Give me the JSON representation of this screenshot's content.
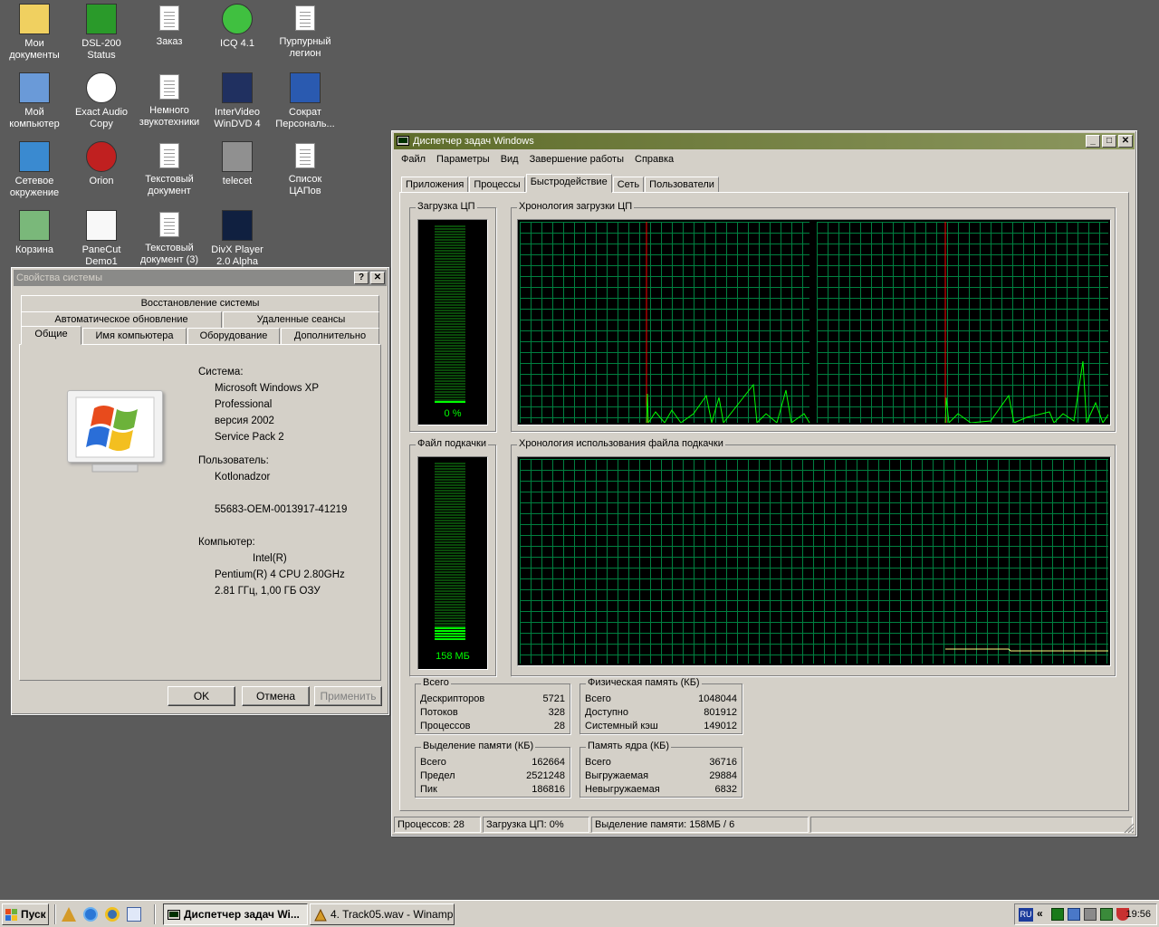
{
  "desktop_icons": [
    {
      "id": "my-docs",
      "label1": "Мои",
      "label2": "документы",
      "icon": "folder-docs-icon"
    },
    {
      "id": "dsl",
      "label1": "DSL-200",
      "label2": "Status",
      "icon": "network-arrows-icon"
    },
    {
      "id": "zakaz",
      "label1": "Заказ",
      "label2": "",
      "icon": "text-document-icon"
    },
    {
      "id": "icq",
      "label1": "ICQ 4.1",
      "label2": "",
      "icon": "icq-flower-icon"
    },
    {
      "id": "purple",
      "label1": "Пурпурный",
      "label2": "легион",
      "icon": "text-document-icon"
    },
    {
      "id": "mycomp",
      "label1": "Мой",
      "label2": "компьютер",
      "icon": "computer-icon"
    },
    {
      "id": "eac",
      "label1": "Exact Audio",
      "label2": "Copy",
      "icon": "eac-icon"
    },
    {
      "id": "sound",
      "label1": "Немного",
      "label2": "звукотехники",
      "icon": "text-document-icon"
    },
    {
      "id": "windvd",
      "label1": "InterVideo",
      "label2": "WinDVD 4",
      "icon": "windvd-icon"
    },
    {
      "id": "sokrat",
      "label1": "Сократ",
      "label2": "Персональ...",
      "icon": "sokrat-icon"
    },
    {
      "id": "network",
      "label1": "Сетевое",
      "label2": "окружение",
      "icon": "network-places-icon"
    },
    {
      "id": "orion",
      "label1": "Orion",
      "label2": "",
      "icon": "orion-icon"
    },
    {
      "id": "textdoc",
      "label1": "Текстовый",
      "label2": "документ",
      "icon": "text-document-icon"
    },
    {
      "id": "telecet",
      "label1": "telecet",
      "label2": "",
      "icon": "telecet-icon"
    },
    {
      "id": "dac",
      "label1": "Список",
      "label2": "ЦАПов",
      "icon": "text-document-icon"
    },
    {
      "id": "bin",
      "label1": "Корзина",
      "label2": "",
      "icon": "recycle-bin-icon"
    },
    {
      "id": "panecut",
      "label1": "PaneCut",
      "label2": "Demo1",
      "icon": "panecut-icon"
    },
    {
      "id": "textdoc3",
      "label1": "Текстовый",
      "label2": "документ (3)",
      "icon": "text-document-icon"
    },
    {
      "id": "divx",
      "label1": "DivX Player",
      "label2": "2.0 Alpha",
      "icon": "divx-icon"
    }
  ],
  "sysprops": {
    "title": "Свойства системы",
    "tabs_row1": [
      "Восстановление системы"
    ],
    "tabs_row2": [
      "Автоматическое обновление",
      "Удаленные сеансы"
    ],
    "tabs_row3": [
      "Общие",
      "Имя компьютера",
      "Оборудование",
      "Дополнительно"
    ],
    "system_label": "Система:",
    "system_lines": [
      "Microsoft Windows XP",
      "Professional",
      "версия 2002",
      "Service Pack 2"
    ],
    "user_label": "Пользователь:",
    "user_name": "Kotlonadzor",
    "serial": "55683-OEM-0013917-41219",
    "computer_label": "Компьютер:",
    "computer_lines": [
      "Intel(R)",
      "Pentium(R) 4 CPU 2.80GHz",
      "2.81 ГГц, 1,00 ГБ ОЗУ"
    ],
    "ok": "OK",
    "cancel": "Отмена",
    "apply": "Применить"
  },
  "taskmgr": {
    "title": "Диспетчер задач Windows",
    "menu": [
      "Файл",
      "Параметры",
      "Вид",
      "Завершение работы",
      "Справка"
    ],
    "tabs": [
      "Приложения",
      "Процессы",
      "Быстродействие",
      "Сеть",
      "Пользователи"
    ],
    "cpu_usage_label": "Загрузка ЦП",
    "cpu_usage_value": "0 %",
    "cpu_usage_fraction": 0.0,
    "cpu_history_label": "Хронология загрузки ЦП",
    "pf_usage_label": "Файл подкачки",
    "pf_usage_value": "158 МБ",
    "pf_usage_fraction": 0.07,
    "pf_history_label": "Хронология использования файла подкачки",
    "totals": {
      "label": "Всего",
      "rows": [
        [
          "Дескрипторов",
          "5721"
        ],
        [
          "Потоков",
          "328"
        ],
        [
          "Процессов",
          "28"
        ]
      ]
    },
    "physical": {
      "label": "Физическая память (КБ)",
      "rows": [
        [
          "Всего",
          "1048044"
        ],
        [
          "Доступно",
          "801912"
        ],
        [
          "Системный кэш",
          "149012"
        ]
      ]
    },
    "commit": {
      "label": "Выделение памяти (КБ)",
      "rows": [
        [
          "Всего",
          "162664"
        ],
        [
          "Предел",
          "2521248"
        ],
        [
          "Пик",
          "186816"
        ]
      ]
    },
    "kernel": {
      "label": "Память ядра (КБ)",
      "rows": [
        [
          "Всего",
          "36716"
        ],
        [
          "Выгружаемая",
          "29884"
        ],
        [
          "Невыгружаемая",
          "6832"
        ]
      ]
    },
    "status": {
      "processes": "Процессов: 28",
      "cpu": "Загрузка ЦП: 0%",
      "commit": "Выделение памяти: 158МБ / 6"
    }
  },
  "taskbar": {
    "start": "Пуск",
    "tasks": [
      "Диспетчер задач Wi...",
      "4. Track05.wav - Winamp"
    ],
    "lang": "RU",
    "clock": "19:56"
  }
}
